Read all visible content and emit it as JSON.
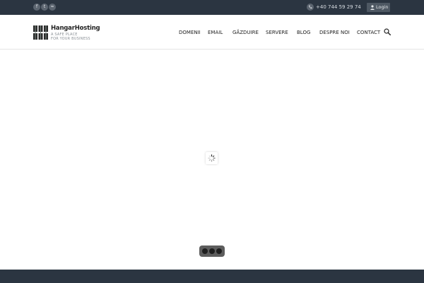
{
  "topbar": {
    "social": [
      {
        "name": "facebook",
        "glyph": "f"
      },
      {
        "name": "twitter",
        "glyph": "t"
      },
      {
        "name": "rss",
        "glyph": "≈"
      }
    ],
    "phone": "+40 744 59 29 74",
    "login_label": "Login"
  },
  "logo": {
    "name": "HangarHosting",
    "tagline_1": "A SAFE PLACE",
    "tagline_2": "FOR YOUR BUSINESS"
  },
  "nav": {
    "items": [
      "DOMENII",
      "EMAIL",
      "GĂZDUIRE",
      "SERVERE",
      "BLOG",
      "DESPRE NOI",
      "CONTACT"
    ]
  },
  "icons": {
    "search": "search-icon",
    "phone": "phone-icon",
    "user": "user-icon",
    "spinner": "loading-spinner-icon"
  },
  "colors": {
    "topbar_bg": "#2b3541",
    "footer_bg": "#2b3541",
    "pager_bg": "#5d5d5d"
  },
  "slider": {
    "pages": 3
  }
}
